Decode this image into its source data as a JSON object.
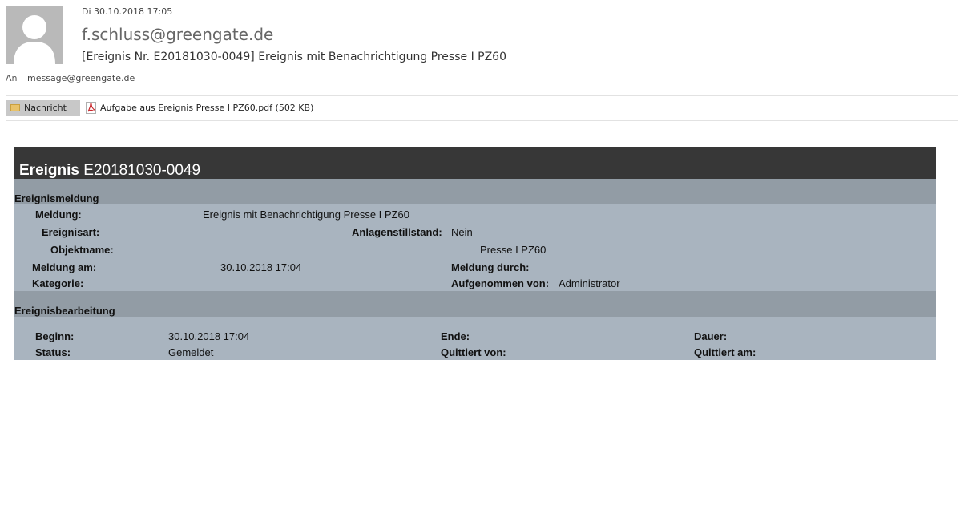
{
  "header": {
    "date": "Di 30.10.2018 17:05",
    "from": "f.schluss@greengate.de",
    "subject": "[Ereignis Nr. E20181030-0049] Ereignis mit Benachrichtigung Presse I PZ60",
    "to_label": "An",
    "to": "message@greengate.de"
  },
  "tabs": {
    "message_label": "Nachricht",
    "attachment_label": "Aufgabe aus Ereignis Presse I PZ60.pdf (502 KB)"
  },
  "report": {
    "title_bold": "Ereignis",
    "title_number": "E20181030-0049",
    "section1": {
      "title": "Ereignismeldung",
      "meldung_label": "Meldung:",
      "meldung_value": "Ereignis mit Benachrichtigung Presse I PZ60",
      "ereignisart_label": "Ereignisart:",
      "anlagenstillstand_label": "Anlagenstillstand:",
      "anlagenstillstand_value": "Nein",
      "objektname_label": "Objektname:",
      "objektname_value": "Presse I PZ60",
      "meldung_am_label": "Meldung am:",
      "meldung_am_value": "30.10.2018 17:04",
      "meldung_durch_label": "Meldung durch:",
      "kategorie_label": "Kategorie:",
      "aufgenommen_label": "Aufgenommen von:",
      "aufgenommen_value": "Administrator"
    },
    "section2": {
      "title": "Ereignisbearbeitung",
      "beginn_label": "Beginn:",
      "beginn_value": "30.10.2018 17:04",
      "ende_label": "Ende:",
      "dauer_label": "Dauer:",
      "status_label": "Status:",
      "status_value": "Gemeldet",
      "quittiert_von_label": "Quittiert von:",
      "quittiert_am_label": "Quittiert am:"
    }
  },
  "colors": {
    "report_bg": "#a9b4bf",
    "section_bg": "#929ca5",
    "title_bar": "#373737",
    "pdf_red": "#c8262b"
  },
  "icons": {
    "avatar": "person-silhouette-icon",
    "message_tab": "envelope-icon",
    "attachment": "pdf-icon"
  }
}
